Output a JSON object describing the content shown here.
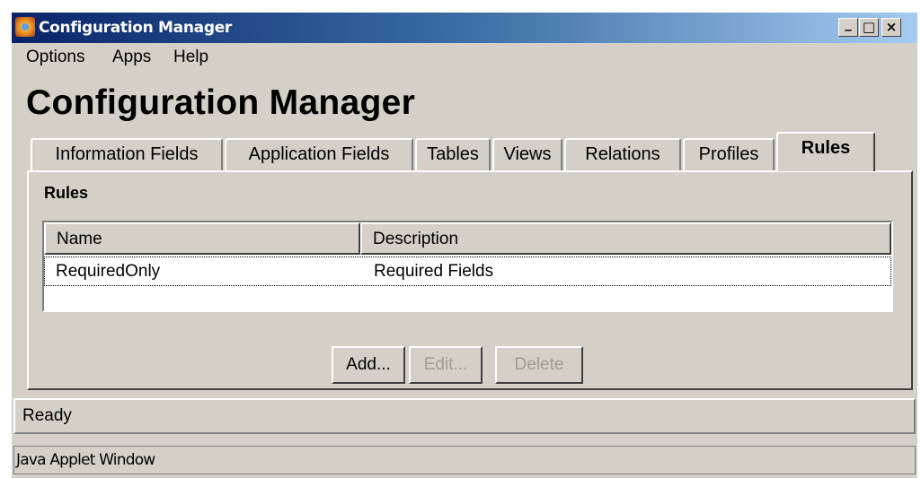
{
  "window": {
    "title": "Configuration Manager",
    "controls": {
      "minimize": "_",
      "maximize": "□",
      "close": "×"
    }
  },
  "menu": [
    "Options",
    "Apps",
    "Help"
  ],
  "header": {
    "title": "Configuration Manager"
  },
  "tabs": [
    {
      "label": "Information Fields",
      "active": false
    },
    {
      "label": "Application Fields",
      "active": false
    },
    {
      "label": "Tables",
      "active": false
    },
    {
      "label": "Views",
      "active": false
    },
    {
      "label": "Relations",
      "active": false
    },
    {
      "label": "Profiles",
      "active": false
    },
    {
      "label": "Rules",
      "active": true
    }
  ],
  "panel": {
    "label": "Rules",
    "table": {
      "columns": [
        "Name",
        "Description"
      ],
      "rows": [
        {
          "name": "RequiredOnly",
          "description": "Required Fields"
        }
      ]
    },
    "buttons": {
      "add": {
        "label": "Add...",
        "enabled": true
      },
      "edit": {
        "label": "Edit...",
        "enabled": false
      },
      "delete": {
        "label": "Delete",
        "enabled": false
      }
    }
  },
  "status": {
    "text": "Ready"
  },
  "applet_label": "Java Applet Window",
  "colors": {
    "face": "#d4d0c8",
    "title_start": "#0a246a",
    "title_end": "#a6caf0",
    "disabled_text": "#a09c94"
  }
}
